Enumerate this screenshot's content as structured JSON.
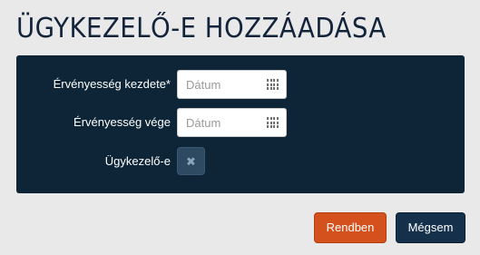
{
  "dialog": {
    "title": "ÜGYKEZELŐ-E HOZZÁADÁSA"
  },
  "form": {
    "valid_from": {
      "label": "Érvényesség kezdete*",
      "placeholder": "Dátum",
      "value": "",
      "icon": "calendar-icon"
    },
    "valid_to": {
      "label": "Érvényesség vége",
      "placeholder": "Dátum",
      "value": "",
      "icon": "calendar-icon"
    },
    "is_case_handler": {
      "label": "Ügykezelő-e",
      "checked": false,
      "mark": "✖",
      "icon": "x-icon"
    }
  },
  "buttons": {
    "ok_label": "Rendben",
    "cancel_label": "Mégsem"
  },
  "colors": {
    "panel_background": "#0d2536",
    "ok_button": "#d4501c",
    "cancel_button": "#14304a",
    "title_text": "#13243a"
  }
}
